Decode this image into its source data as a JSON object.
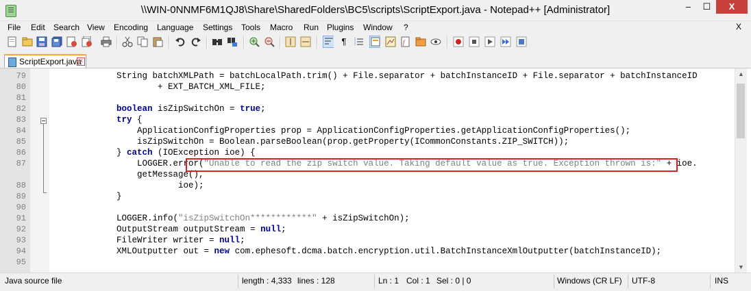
{
  "window": {
    "title": "\\\\WIN-0NNMF6M1QJ8\\Share\\SharedFolders\\BC5\\scripts\\ScriptExport.java - Notepad++ [Administrator]",
    "minimize_glyph": "–",
    "maximize_glyph": "☐",
    "close_glyph": "X"
  },
  "menu": {
    "items": [
      "File",
      "Edit",
      "Search",
      "View",
      "Encoding",
      "Language",
      "Settings",
      "Tools",
      "Macro",
      "Run",
      "Plugins",
      "Window",
      "?"
    ],
    "close_glyph": "X"
  },
  "toolbar": {
    "icons": [
      "new-file-icon",
      "open-file-icon",
      "save-icon",
      "save-all-icon",
      "close-file-icon",
      "close-all-icon",
      "print-icon",
      "cut-icon",
      "copy-icon",
      "paste-icon",
      "undo-icon",
      "redo-icon",
      "find-icon",
      "replace-icon",
      "zoom-in-icon",
      "zoom-out-icon",
      "sync-vertical-icon",
      "sync-horizontal-icon",
      "word-wrap-icon",
      "show-all-chars-icon",
      "indent-guide-icon",
      "user-language-icon",
      "doc-map-icon",
      "function-list-icon",
      "folder-workspace-icon",
      "monitor-icon",
      "record-macro-icon",
      "stop-record-icon",
      "play-macro-icon",
      "play-multiple-icon",
      "save-macro-icon"
    ]
  },
  "tab": {
    "label": "ScriptExport.java"
  },
  "editor": {
    "lines": [
      {
        "num": "79",
        "tokens": [
          {
            "t": "            String batchXMLPath = batchLocalPath.trim() + File.separator + batchInstanceID + File.separator + batchInstanceID"
          }
        ]
      },
      {
        "num": "80",
        "tokens": [
          {
            "t": "                    + EXT_BATCH_XML_FILE;"
          }
        ]
      },
      {
        "num": "81",
        "tokens": [
          {
            "t": ""
          }
        ]
      },
      {
        "num": "82",
        "tokens": [
          {
            "t": "            "
          },
          {
            "t": "boolean",
            "c": "kw"
          },
          {
            "t": " isZipSwitchOn = "
          },
          {
            "t": "true",
            "c": "kw"
          },
          {
            "t": ";"
          }
        ]
      },
      {
        "num": "83",
        "tokens": [
          {
            "t": "            "
          },
          {
            "t": "try",
            "c": "kw"
          },
          {
            "t": " {"
          }
        ]
      },
      {
        "num": "84",
        "tokens": [
          {
            "t": "                ApplicationConfigProperties prop = ApplicationConfigProperties.getApplicationConfigProperties();"
          }
        ]
      },
      {
        "num": "85",
        "tokens": [
          {
            "t": "                isZipSwitchOn = Boolean.parseBoolean(prop.getProperty(ICommonConstants.ZIP_SWITCH));"
          }
        ]
      },
      {
        "num": "86",
        "tokens": [
          {
            "t": "            } "
          },
          {
            "t": "catch",
            "c": "kw"
          },
          {
            "t": " (IOException ioe) {"
          }
        ]
      },
      {
        "num": "87",
        "tokens": [
          {
            "t": "                LOGGER.error("
          },
          {
            "t": "\"Unable to read the zip switch value. Taking default value as true. Exception thrown is:\"",
            "c": "str"
          },
          {
            "t": " + ioe."
          }
        ]
      },
      {
        "num": "",
        "tokens": [
          {
            "t": "                getMessage(),"
          }
        ]
      },
      {
        "num": "88",
        "tokens": [
          {
            "t": "                        ioe);"
          }
        ]
      },
      {
        "num": "89",
        "tokens": [
          {
            "t": "            }"
          }
        ]
      },
      {
        "num": "90",
        "tokens": [
          {
            "t": ""
          }
        ]
      },
      {
        "num": "91",
        "tokens": [
          {
            "t": "            LOGGER.info("
          },
          {
            "t": "\"isZipSwitchOn************\"",
            "c": "str"
          },
          {
            "t": " + isZipSwitchOn);"
          }
        ]
      },
      {
        "num": "92",
        "tokens": [
          {
            "t": "            OutputStream outputStream = "
          },
          {
            "t": "null",
            "c": "kw"
          },
          {
            "t": ";"
          }
        ]
      },
      {
        "num": "93",
        "tokens": [
          {
            "t": "            FileWriter writer = "
          },
          {
            "t": "null",
            "c": "kw"
          },
          {
            "t": ";"
          }
        ]
      },
      {
        "num": "94",
        "tokens": [
          {
            "t": "            XMLOutputter out = "
          },
          {
            "t": "new",
            "c": "kw"
          },
          {
            "t": " com.ephesoft.dcma.batch.encryption.util.BatchInstanceXmlOutputter(batchInstanceID);"
          }
        ]
      },
      {
        "num": "95",
        "tokens": [
          {
            "t": ""
          }
        ]
      }
    ]
  },
  "status": {
    "file_type": "Java source file",
    "length": "length : 4,333",
    "lines": "lines : 128",
    "ln": "Ln : 1",
    "col": "Col : 1",
    "sel": "Sel : 0 | 0",
    "eol": "Windows (CR LF)",
    "encoding": "UTF-8",
    "mode": "INS"
  }
}
